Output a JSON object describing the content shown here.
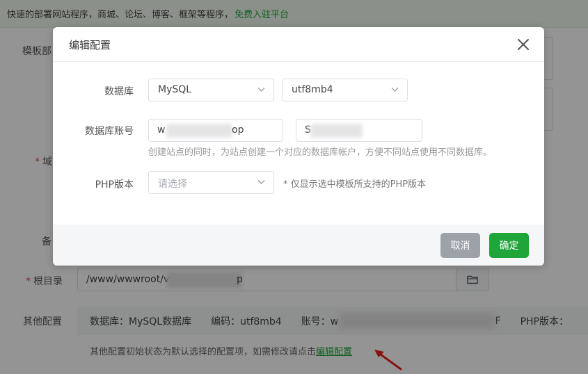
{
  "promo": {
    "text": "快速的部署网站程序，商城、论坛、博客、框架等程序，",
    "link": "免费入驻平台"
  },
  "background_form": {
    "template_label": "模板部",
    "domain_label": "域",
    "remark_label": "备",
    "root_dir": {
      "label": "根目录",
      "required_mark": "*",
      "value_prefix": "/www/wwwroot/v",
      "value_suffix": "p"
    },
    "other_config": {
      "label": "其他配置",
      "db_item": "数据库：MySQL数据库",
      "encoding_item": "编码：utf8mb4",
      "account_item": "账号：w",
      "trail_char": "F",
      "php_item": "PHP版本："
    },
    "hint": {
      "text": "其他配置初始状态为默认选择的配置项，如需修改请点击",
      "link": "编辑配置"
    }
  },
  "modal": {
    "title": "编辑配置",
    "close_icon": "close-icon",
    "database": {
      "label": "数据库",
      "type_value": "MySQL",
      "charset_value": "utf8mb4"
    },
    "account": {
      "label": "数据库账号",
      "username_prefix": "w",
      "username_suffix": "op",
      "password_prefix": "S",
      "help": "创建站点的同时，为站点创建一个对应的数据库帐户，方便不同站点使用不同数据库。"
    },
    "php": {
      "label": "PHP版本",
      "placeholder": "请选择",
      "note": "* 仅显示选中模板所支持的PHP版本"
    },
    "buttons": {
      "cancel": "取消",
      "confirm": "确定"
    }
  },
  "colors": {
    "accent": "#20a53a",
    "cancel": "#9da2a8",
    "required": "#e04040",
    "annotation_arrow": "#e8221b"
  }
}
